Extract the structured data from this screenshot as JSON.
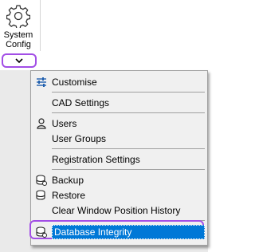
{
  "ribbon": {
    "system_config_label_line1": "System",
    "system_config_label_line2": "Config",
    "system_config_icon": "gear-icon",
    "dropdown_icon": "chevron-down-icon"
  },
  "menu": {
    "items": [
      {
        "label": "Customise",
        "icon": "sliders-icon"
      },
      {
        "label": "CAD Settings",
        "icon": ""
      },
      {
        "label": "Users",
        "icon": "user-icon"
      },
      {
        "label": "User Groups",
        "icon": ""
      },
      {
        "label": "Registration Settings",
        "icon": ""
      },
      {
        "label": "Backup",
        "icon": "database-backup-icon"
      },
      {
        "label": "Restore",
        "icon": "database-restore-icon"
      },
      {
        "label": "Clear Window Position History",
        "icon": ""
      },
      {
        "label": "Database Integrity",
        "icon": "database-integrity-icon"
      }
    ]
  },
  "colors": {
    "accent_outline": "#a24ee6",
    "selection": "#0078d7"
  }
}
